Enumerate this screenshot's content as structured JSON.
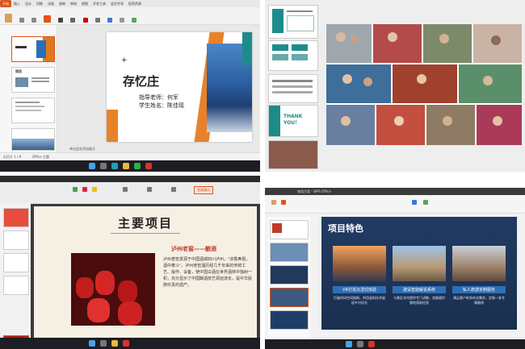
{
  "q1": {
    "tabs": [
      "开始",
      "插入",
      "设计",
      "切换",
      "动画",
      "放映",
      "审阅",
      "视图",
      "开发工具",
      "会员专享",
      "稻壳资源"
    ],
    "active_tab": "开始",
    "slide_title": "存忆庄",
    "teacher_line": "指导老师：何军",
    "student_line": "学生姓名：陈佳瑶",
    "notes_placeholder": "单击此处添加备注",
    "thumb2_title": "项目",
    "status_left": "幻灯片 1 / 9",
    "status_theme": "Office 主题"
  },
  "q2": {
    "thank_you": "THANK YOU！"
  },
  "q3": {
    "heading": "主要项目",
    "subheading": "泸州老窖——酿酒",
    "paragraph": "泸州老窖发源于中国酒城四川泸州，\"浓香鼻祖，酒中泰斗\"，泸州老窖酒历经几千年来的传统工艺、操作、设备，使中国白酒在世界酒林中独树一帜，充分显示了中国酿酒技艺源远流长，是中华民族珍贵的遗产。",
    "toolbar_tag": "完成演示"
  },
  "q4": {
    "slide_title": "项目特色",
    "features": [
      {
        "label": "VR打造沉浸式体验",
        "desc": "打破时间空间限制，利用虚拟技术展现乡村风光"
      },
      {
        "label": "建设智能解说系统",
        "desc": "与景区合作提供专门讲解，游客随时随地获取信息"
      },
      {
        "label": "私人旅游定制服务",
        "desc": "满足客户的多样化需求，定制一条专属路线"
      }
    ],
    "app_title": "旅游方案 - WPS Office"
  }
}
